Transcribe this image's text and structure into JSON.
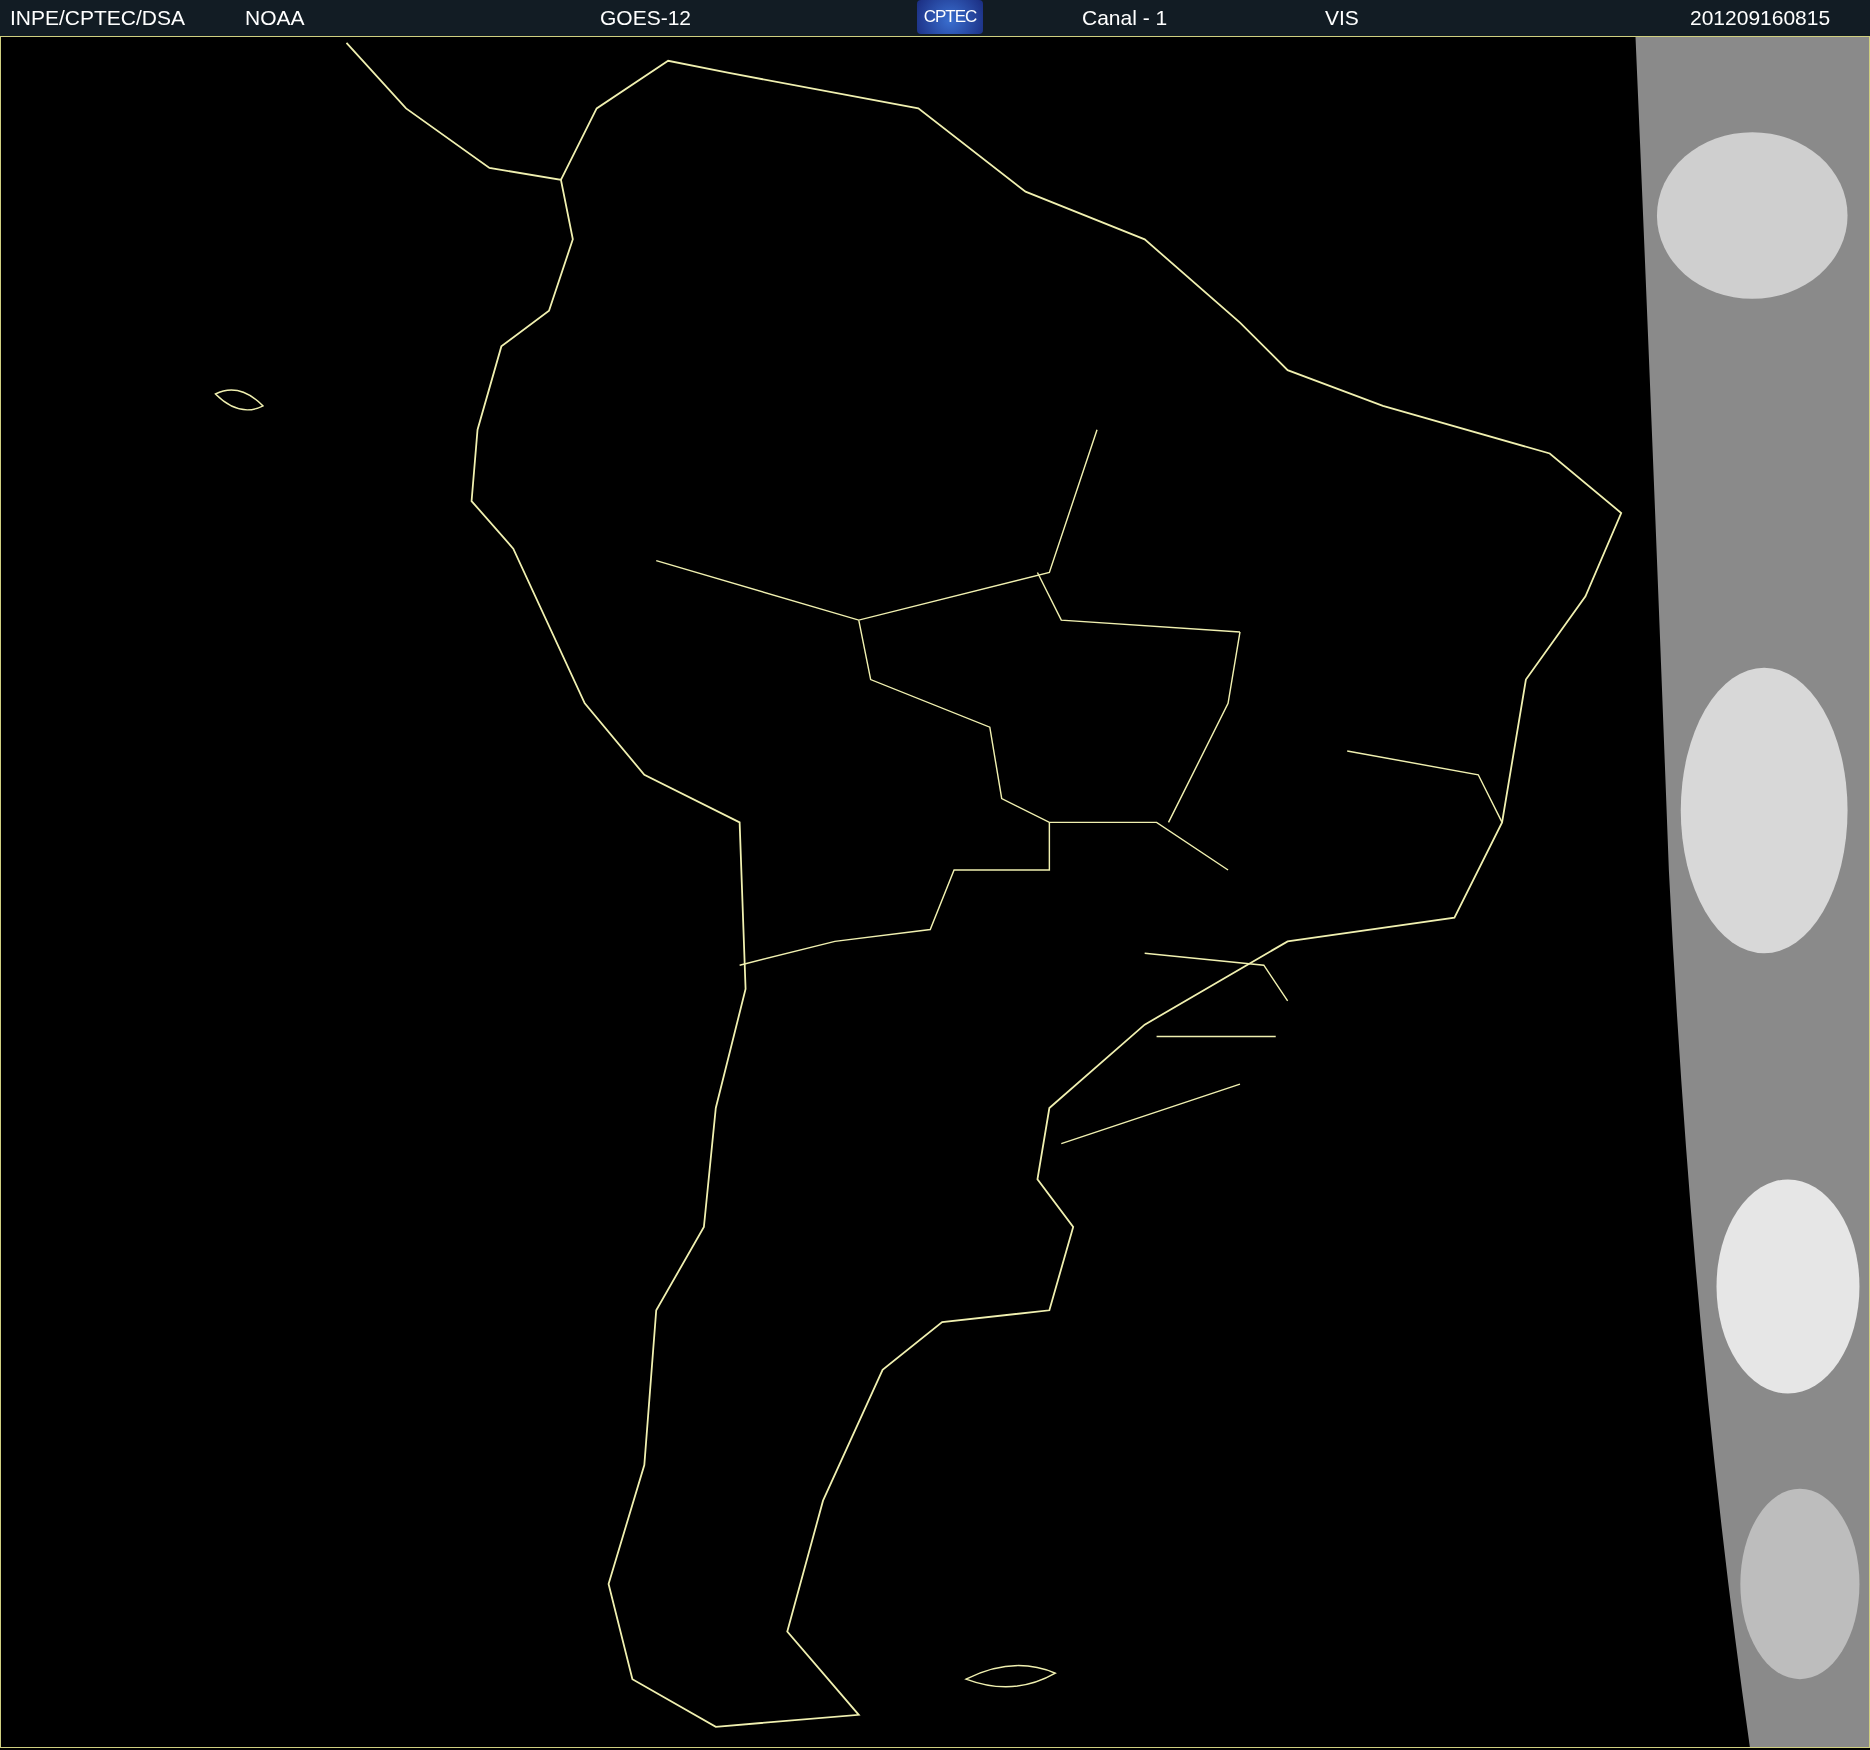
{
  "header": {
    "items": [
      {
        "kind": "text",
        "text": "INPE/CPTEC/DSA"
      },
      {
        "kind": "text",
        "text": "NOAA"
      },
      {
        "kind": "text",
        "text": "GOES-12"
      },
      {
        "kind": "logo",
        "text": "CPTEC"
      },
      {
        "kind": "text",
        "text": "Canal - 1"
      },
      {
        "kind": "text",
        "text": "VIS"
      },
      {
        "kind": "text",
        "text": "201209160815"
      }
    ]
  }
}
